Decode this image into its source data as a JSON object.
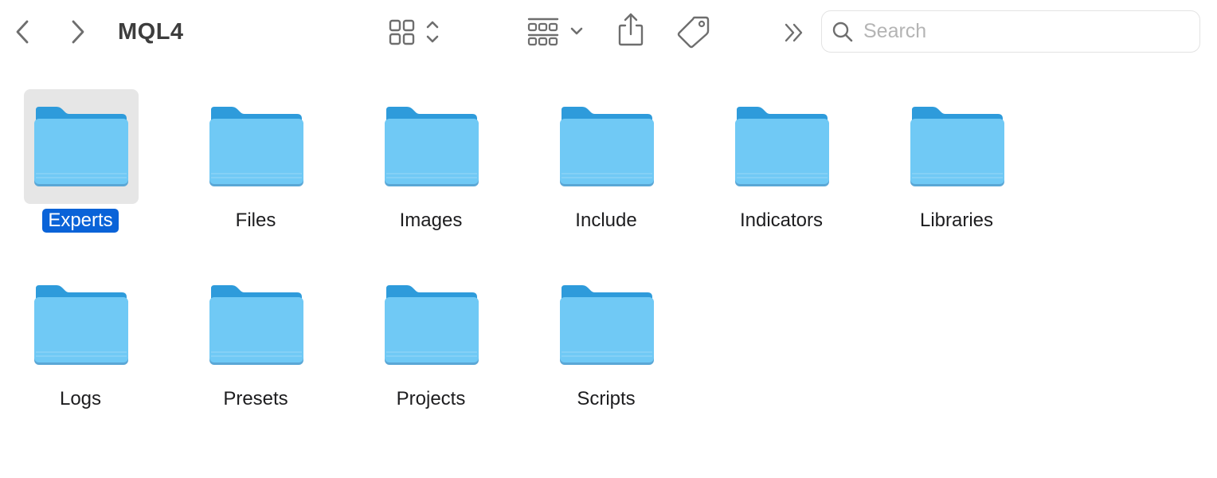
{
  "window": {
    "title": "MQL4"
  },
  "toolbar": {
    "back_icon": "chevron-left-icon",
    "forward_icon": "chevron-right-icon",
    "view_icon": "icon-grid-view-icon",
    "group_icon": "group-by-icon",
    "share_icon": "share-icon",
    "tag_icon": "tag-icon",
    "more_icon": "double-chevron-right-icon"
  },
  "search": {
    "placeholder": "Search",
    "value": ""
  },
  "colors": {
    "folder_front": "#70C9F5",
    "folder_back": "#2E9BDB",
    "selection_label_bg": "#0A63D8",
    "selection_icon_bg": "#E6E6E6"
  },
  "items": [
    {
      "name": "Experts",
      "selected": true
    },
    {
      "name": "Files",
      "selected": false
    },
    {
      "name": "Images",
      "selected": false
    },
    {
      "name": "Include",
      "selected": false
    },
    {
      "name": "Indicators",
      "selected": false
    },
    {
      "name": "Libraries",
      "selected": false
    },
    {
      "name": "Logs",
      "selected": false
    },
    {
      "name": "Presets",
      "selected": false
    },
    {
      "name": "Projects",
      "selected": false
    },
    {
      "name": "Scripts",
      "selected": false
    }
  ]
}
